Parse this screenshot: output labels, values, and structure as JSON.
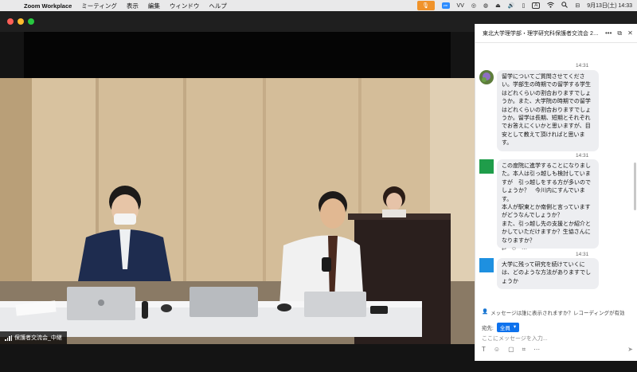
{
  "menubar": {
    "app": "Zoom Workplace",
    "menus": [
      "ミーティング",
      "表示",
      "編集",
      "ウィンドウ",
      "ヘルプ"
    ],
    "clock": "9月13日(土)  14:33",
    "keyboard": "A"
  },
  "video": {
    "participant_name": "保護者交流会_中継"
  },
  "chat": {
    "title": "東北大学理学部・理学研究科保護者交流会 2…",
    "messages": [
      {
        "time": "14:31",
        "text": "留学についてご質問させてください。学部生の時期での留学する学生はどれくらいの割合おりますでしょうか。また、大学院の時期での留学はどれくらいの割合おりますでしょうか。留学は長期、短期とそれぞれでお答えにくいかと思いますが、目安として教えて頂ければと思います。",
        "avatar": "flower-avatar"
      },
      {
        "time": "14:31",
        "text": "この度院に進学することになりました。本人は引っ越しも検討していますが　引っ越しをする方が多いのでしょうか？　今川内にすんでいます。\n本人が駅東とか南側と言っていますがどうなんでしょうか？\nまた、引っ越し先の支援とか紹介とかしていただけますか？生協さんになりますか？",
        "avatar": "green-avatar"
      },
      {
        "time": "14:31",
        "text": "大学に残って研究を続けていくには、どのような方法がありますでしょうか",
        "avatar": "blue-avatar"
      }
    ],
    "notice": "メッセージは誰に表示されますか？レコーディングが有効",
    "to_label": "宛先:",
    "to_value": "全員",
    "input_placeholder": "ここにメッセージを入力..."
  },
  "colors": {
    "accent": "#0e72ed",
    "mic": "#f0932b",
    "green_avatar": "#1f9d4a",
    "blue_avatar": "#1e90e0"
  }
}
